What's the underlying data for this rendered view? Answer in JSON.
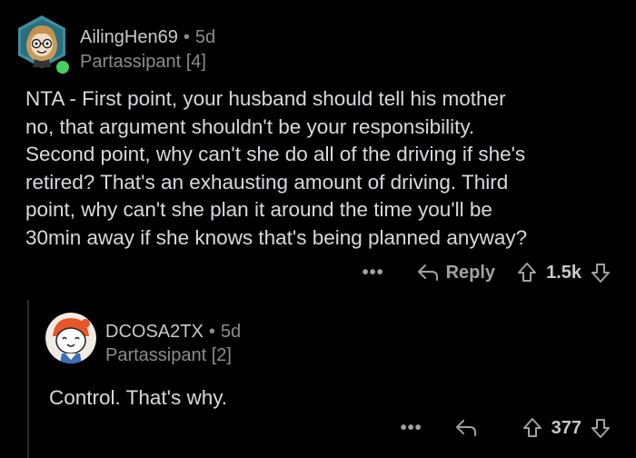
{
  "comments": [
    {
      "username": "AilingHen69",
      "separator": "•",
      "age": "5d",
      "flair": "Partassipant [4]",
      "body_lines": [
        "NTA - First point, your husband should tell his mother",
        "no, that argument shouldn't be your responsibility.",
        "Second point, why can't she do all of the driving if she's",
        "retired? That's an exhausting amount of driving. Third",
        "point, why can't she plan it around the time you'll be",
        "30min away if she knows that's being planned anyway?"
      ],
      "more_label": "•••",
      "reply_label": "Reply",
      "score": "1.5k",
      "online": true,
      "avatar_icon": "avatar-girl-glasses-icon"
    },
    {
      "username": "DCOSA2TX",
      "separator": "•",
      "age": "5d",
      "flair": "Partassipant [2]",
      "body": "Control. That's why.",
      "more_label": "•••",
      "reply_label": "",
      "score": "377",
      "avatar_icon": "avatar-redhat-icon"
    }
  ],
  "colors": {
    "background": "#000000",
    "text": "#d7dadc",
    "meta": "#8a8c8e",
    "online": "#46d160",
    "avatar1_bg": "#2e7d8c",
    "avatar2_bg": "#e8e2d8"
  }
}
